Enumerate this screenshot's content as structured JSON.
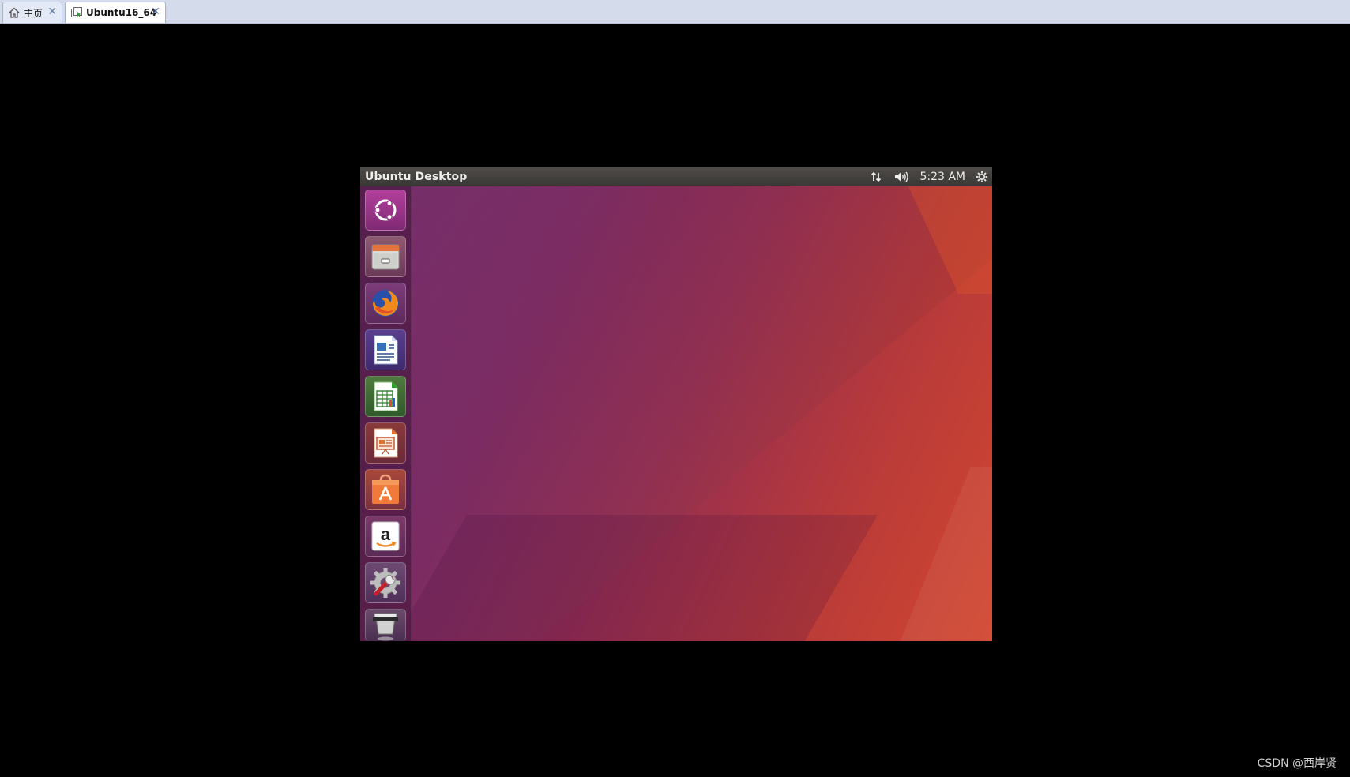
{
  "tabs": [
    {
      "label": "主页",
      "icon": "home-icon",
      "active": false
    },
    {
      "label": "Ubuntu16_64",
      "icon": "vm-icon",
      "active": true
    }
  ],
  "vm": {
    "topbar": {
      "title": "Ubuntu Desktop",
      "clock": "5:23 AM",
      "indicators": [
        "network-icon",
        "volume-icon",
        "settings-gear-icon"
      ]
    },
    "launcher": [
      "ubuntu-dash-icon",
      "files-icon",
      "firefox-icon",
      "libreoffice-writer-icon",
      "libreoffice-calc-icon",
      "libreoffice-impress-icon",
      "software-center-icon",
      "amazon-icon",
      "system-settings-icon",
      "trash-icon"
    ]
  },
  "watermark": "CSDN @西岸贤",
  "colors": {
    "tabbar": "#d4dcec",
    "topbar": "#3f3c3a",
    "wallpaper_left": "#6a1c60",
    "wallpaper_right": "#d2472e"
  }
}
